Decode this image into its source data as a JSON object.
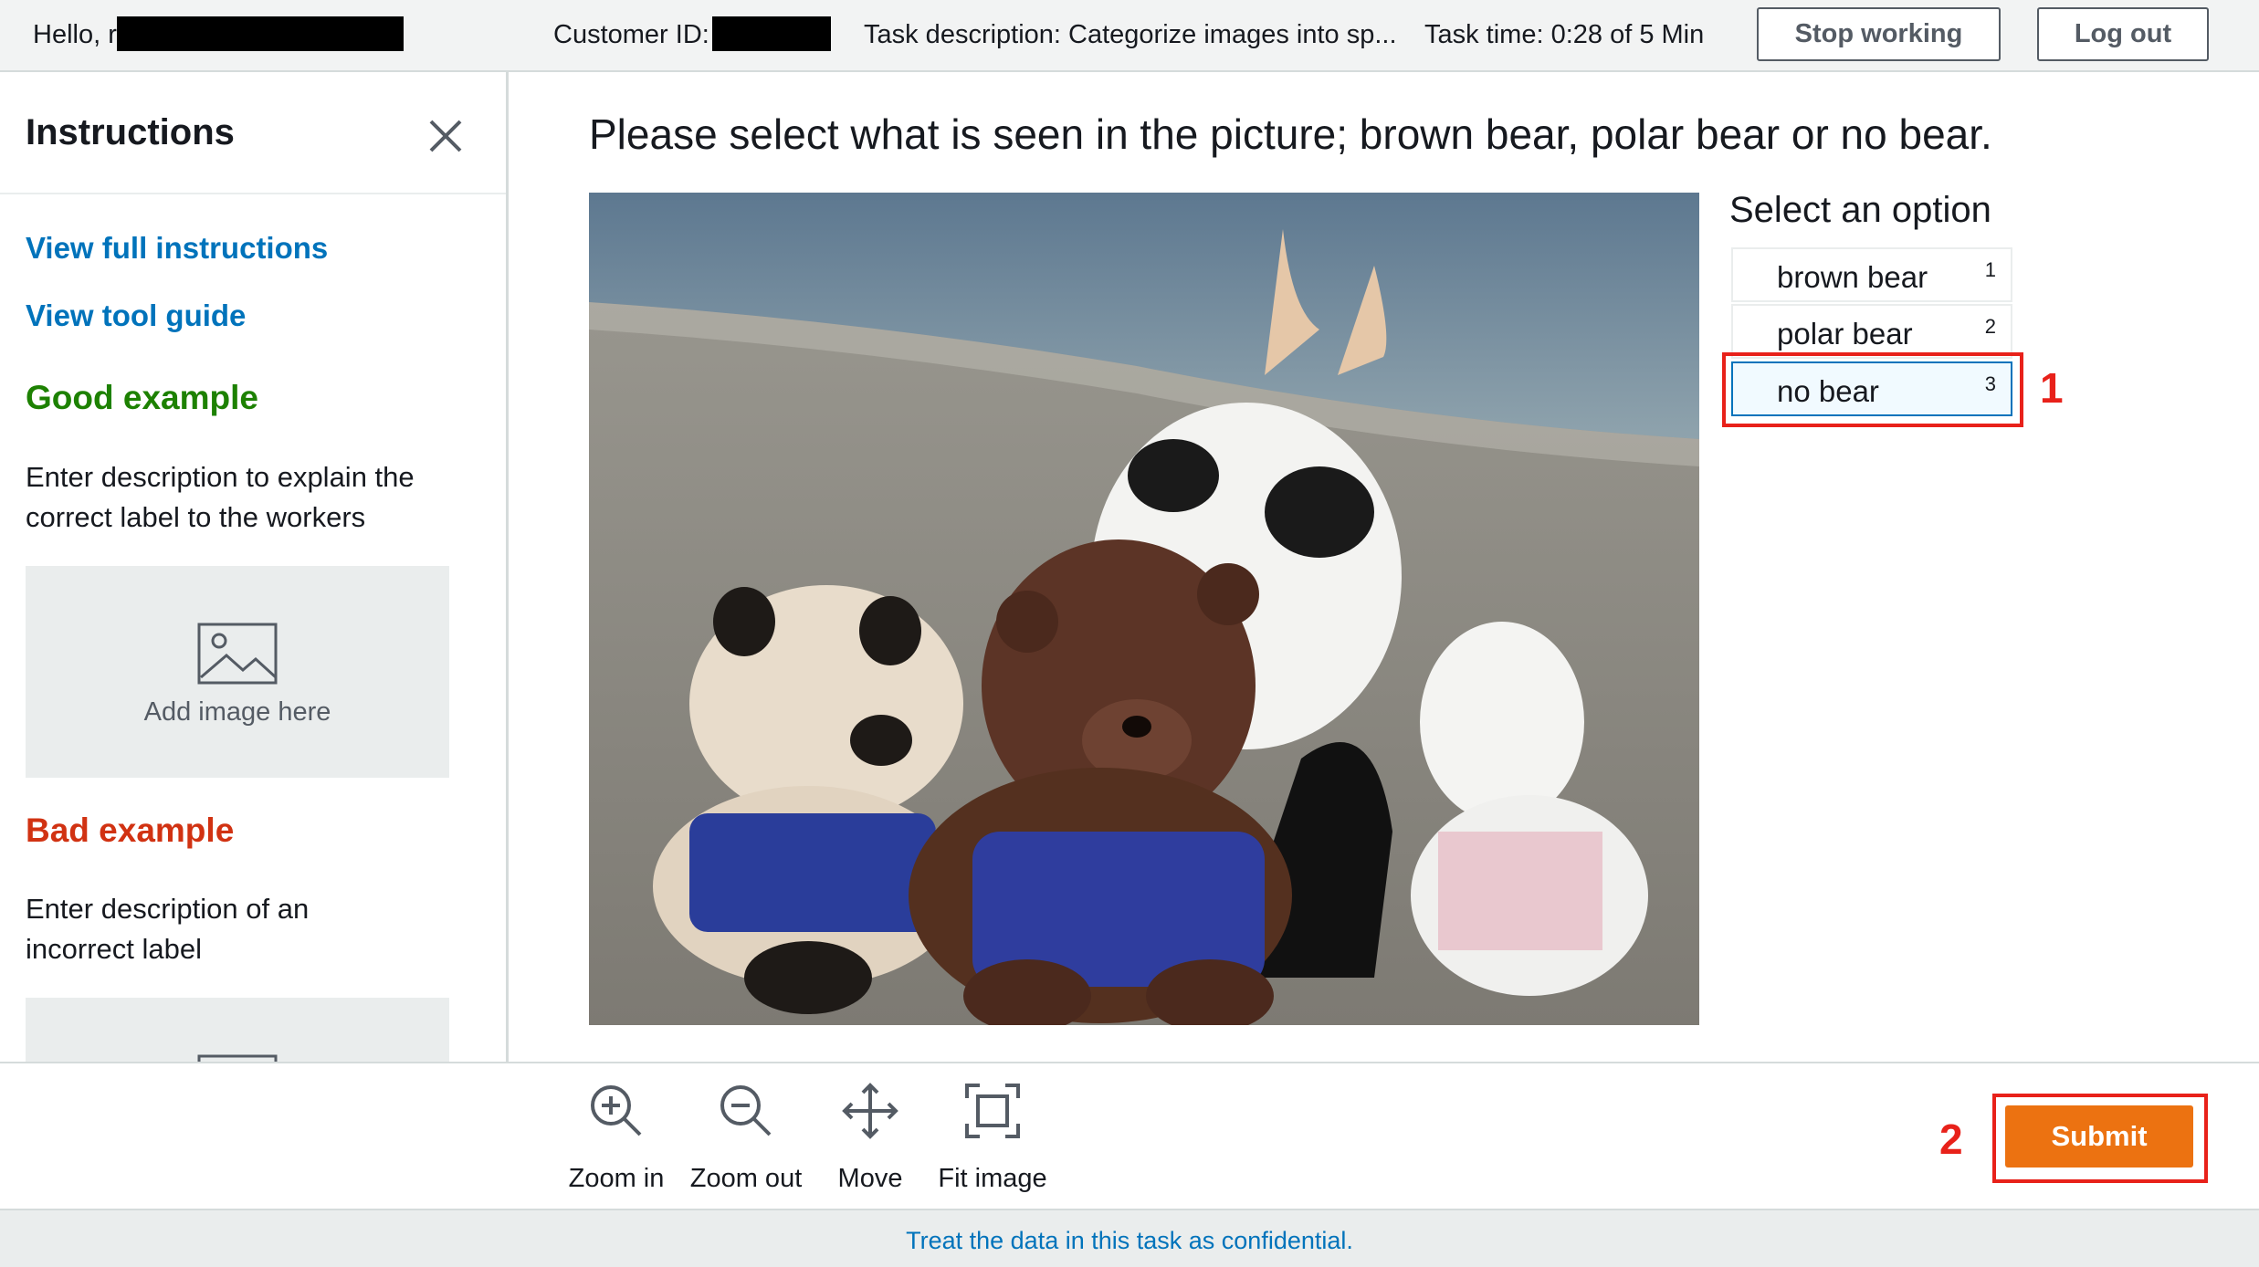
{
  "topbar": {
    "hello": "Hello, r",
    "customer_label": "Customer ID:",
    "task_description": "Task description: Categorize images into sp...",
    "task_time": "Task time: 0:28 of 5 Min",
    "stop_button": "Stop working",
    "logout_button": "Log out"
  },
  "sidebar": {
    "title": "Instructions",
    "link_full": "View full instructions",
    "link_tool": "View tool guide",
    "good_heading": "Good example",
    "good_text": "Enter description to explain the correct label to the workers",
    "add_image": "Add image here",
    "bad_heading": "Bad example",
    "bad_text": "Enter description of an incorrect label"
  },
  "main": {
    "question": "Please select what is seen in the picture; brown bear, polar bear or no bear.",
    "options_title": "Select an option",
    "options": [
      {
        "label": "brown bear",
        "key": "1"
      },
      {
        "label": "polar bear",
        "key": "2"
      },
      {
        "label": "no bear",
        "key": "3"
      }
    ],
    "selected_option": "no bear",
    "annotation_1": "1",
    "annotation_2": "2"
  },
  "toolbar": {
    "zoom_in": "Zoom in",
    "zoom_out": "Zoom out",
    "move": "Move",
    "fit": "Fit image",
    "submit": "Submit"
  },
  "footer": {
    "notice": "Treat the data in this task as confidential."
  },
  "colors": {
    "link": "#0073bb",
    "good": "#1d8102",
    "bad": "#d13212",
    "submit": "#ec7211",
    "annotation": "#e8211a"
  }
}
